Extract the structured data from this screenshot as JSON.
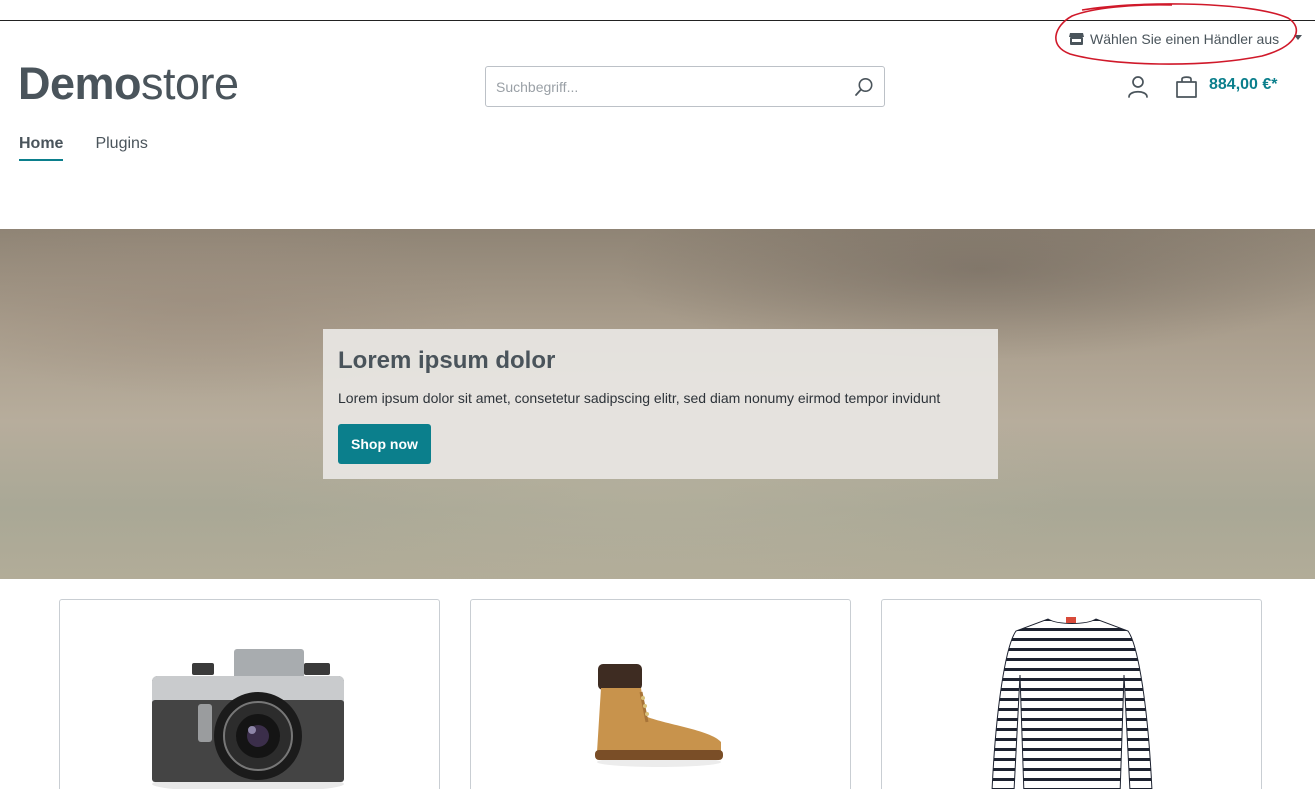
{
  "header": {
    "merchant_selector": {
      "label": "Wählen Sie einen Händler aus",
      "icon": "store-icon"
    },
    "logo": {
      "bold": "Demo",
      "light": "store"
    },
    "search": {
      "placeholder": "Suchbegriff...",
      "value": "",
      "icon": "search-icon"
    },
    "account": {
      "icon": "user-icon"
    },
    "cart": {
      "icon": "shopping-bag-icon",
      "total": "884,00 €*"
    }
  },
  "nav": {
    "items": [
      {
        "label": "Home",
        "active": true
      },
      {
        "label": "Plugins",
        "active": false
      }
    ]
  },
  "hero": {
    "title": "Lorem ipsum dolor",
    "text": "Lorem ipsum dolor sit amet, consetetur sadipscing elitr, sed diam nonumy eirmod tempor invidunt",
    "button_label": "Shop now"
  },
  "products": [
    {
      "image": "camera"
    },
    {
      "image": "boot"
    },
    {
      "image": "striped-shirt"
    }
  ],
  "colors": {
    "accent": "#0b7f8c",
    "text": "#4a545b",
    "annotation": "#d0192a"
  }
}
